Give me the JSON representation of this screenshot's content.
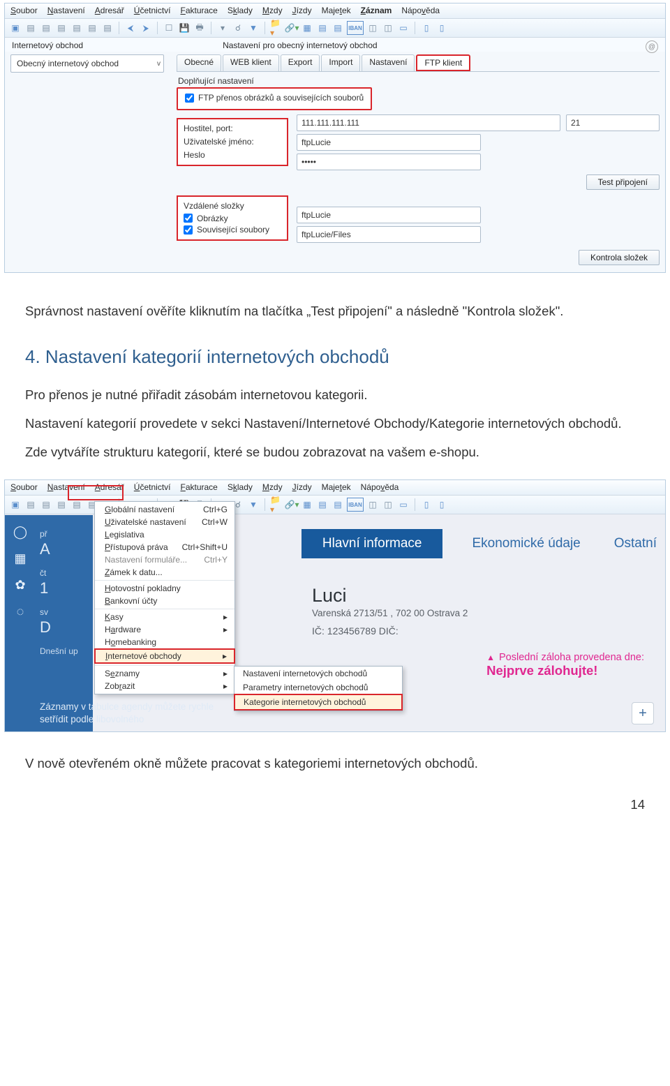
{
  "screenshot1": {
    "menu": [
      "Soubor",
      "Nastavení",
      "Adresář",
      "Účetnictví",
      "Fakturace",
      "Sklady",
      "Mzdy",
      "Jízdy",
      "Majetek",
      "Záznam",
      "Nápověda"
    ],
    "breadcrumb1": "Internetový obchod",
    "breadcrumb2": "Nastavení pro obecný internetový obchod",
    "combo": "Obecný internetový obchod",
    "tabs": [
      "Obecné",
      "WEB klient",
      "Export",
      "Import",
      "Nastavení",
      "FTP klient"
    ],
    "activeTabIndex": 5,
    "section_label": "Doplňující nastavení",
    "ftp_checkbox": "FTP přenos obrázků a souvisejících souborů",
    "host_labels": {
      "host": "Hostitel, port:",
      "user": "Uživatelské jméno:",
      "pass": "Heslo"
    },
    "host_values": {
      "host": "111.111.111.111",
      "port": "21",
      "user": "ftpLucie",
      "pass": "•••••"
    },
    "btn_test": "Test připojení",
    "remote_group_label": "Vzdálené složky",
    "remote_images_chk": "Obrázky",
    "remote_files_chk": "Související soubory",
    "remote_images_val": "ftpLucie",
    "remote_files_val": "ftpLucie/Files",
    "btn_check_folders": "Kontrola složek"
  },
  "doc": {
    "p1": "Správnost nastavení ověříte kliknutím na tlačítka „Test připojení\" a následně \"Kontrola složek\".",
    "h2": "4. Nastavení kategorií internetových obchodů",
    "p2": "Pro přenos je nutné přiřadit zásobám internetovou kategorii.",
    "p3": "Nastavení kategorií provedete v sekci Nastavení/Internetové Obchody/Kategorie internetových obchodů.",
    "p4": "Zde vytváříte strukturu kategorií, které se budou zobrazovat na vašem e-shopu."
  },
  "screenshot2": {
    "menu": [
      "Soubor",
      "Nastavení",
      "Adresář",
      "Účetnictví",
      "Fakturace",
      "Sklady",
      "Mzdy",
      "Jízdy",
      "Majetek",
      "Nápověda"
    ],
    "dropdown": [
      {
        "label": "Globální nastavení",
        "short": "Ctrl+G"
      },
      {
        "label": "Uživatelské nastavení",
        "short": "Ctrl+W"
      },
      {
        "label": "Legislativa",
        "short": ""
      },
      {
        "label": "Přístupová práva",
        "short": "Ctrl+Shift+U"
      },
      {
        "label": "Nastavení formuláře...",
        "short": "Ctrl+Y"
      },
      {
        "label": "Zámek k datu...",
        "short": ""
      },
      {
        "label": "Hotovostní pokladny",
        "short": ""
      },
      {
        "label": "Bankovní účty",
        "short": ""
      },
      {
        "label": "Kasy",
        "short": "▸"
      },
      {
        "label": "Hardware",
        "short": "▸"
      },
      {
        "label": "Homebanking",
        "short": ""
      },
      {
        "label": "Internetové obchody",
        "short": "▸"
      },
      {
        "label": "Seznamy",
        "short": "▸"
      },
      {
        "label": "Zobrazit",
        "short": "▸"
      }
    ],
    "submenu": [
      "Nastavení internetových obchodů",
      "Parametry internetových obchodů",
      "Kategorie internetových obchodů"
    ],
    "sidebar_texts": {
      "pr": "př",
      "A": "A",
      "ct": "čt",
      "num": "1",
      "sv": "sv",
      "D": "D",
      "dnes": "Dnešní up"
    },
    "toptabs": [
      "Hlavní informace",
      "Ekonomické údaje",
      "Ostatní"
    ],
    "company_name": "Luci",
    "company_addr": "Varenská 2713/51 , 702 00 Ostrava 2",
    "company_ids": "IČ: 123456789  DIČ:",
    "pink1": "Poslední záloha provedena dne:",
    "pink2": "Nejprve zálohujte!",
    "tip": "Záznamy v tabulce agendy můžete rychle setřídit podle libovolného"
  },
  "doc2": {
    "p5": "V nově otevřeném okně můžete pracovat s kategoriemi internetových obchodů."
  },
  "page_number": "14"
}
